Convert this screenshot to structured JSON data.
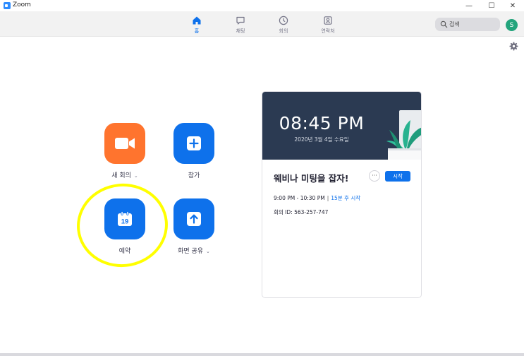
{
  "window": {
    "title": "Zoom",
    "controls": {
      "minimize": "—",
      "maximize": "☐",
      "close": "✕"
    }
  },
  "nav": {
    "tabs": [
      {
        "label": "홈",
        "icon": "home-icon",
        "active": true
      },
      {
        "label": "채팅",
        "icon": "chat-icon",
        "active": false
      },
      {
        "label": "회의",
        "icon": "clock-icon",
        "active": false
      },
      {
        "label": "연락처",
        "icon": "contacts-icon",
        "active": false
      }
    ],
    "search": {
      "placeholder": "검색",
      "icon": "search-icon"
    },
    "avatar_initial": "S"
  },
  "actions": {
    "new_meeting": {
      "label": "새 회의",
      "caret": "⌄",
      "icon": "video-camera-icon",
      "color": "#ff742e"
    },
    "join": {
      "label": "참가",
      "icon": "plus-icon",
      "color": "#0e71eb"
    },
    "schedule": {
      "label": "예약",
      "icon": "calendar-icon",
      "day": "19",
      "color": "#0e71eb"
    },
    "share_screen": {
      "label": "화면 공유",
      "caret": "⌄",
      "icon": "share-up-arrow-icon",
      "color": "#0e71eb"
    }
  },
  "meeting_card": {
    "clock": "08:45 PM",
    "date": "2020년 3월 4일 수요일",
    "title": "웨비나 미팅을 잡자!",
    "more_label": "···",
    "start_label": "시작",
    "time_range": "9:00 PM - 10:30 PM",
    "separator": "|",
    "starts_in": "15분 후 시작",
    "meeting_id": "회의 ID: 563-257-747"
  },
  "colors": {
    "accent": "#0e71eb",
    "orange": "#ff742e",
    "banner": "#2b3a52",
    "highlight": "#ffff00",
    "avatar": "#23a47c"
  }
}
